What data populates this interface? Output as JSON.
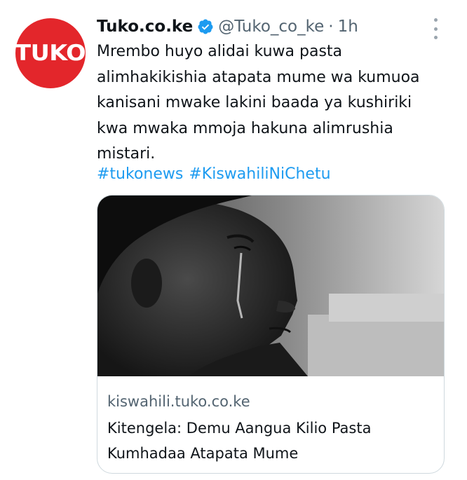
{
  "account": {
    "avatar_text": "TUKO",
    "name": "Tuko.co.ke",
    "handle": "@Tuko_co_ke",
    "separator": "·",
    "time": "1h"
  },
  "tweet": {
    "text": "Mrembo huyo alidai kuwa pasta alimhakikishia atapata mume wa kumuoa kanisani mwake lakini baada ya kushiriki kwa mwaka mmoja hakuna alimrushia mistari.",
    "hashtags": [
      "#tukonews",
      "#KiswahiliNiChetu"
    ]
  },
  "card": {
    "domain": "kiswahili.tuko.co.ke",
    "title": "Kitengela: Demu Aangua Kilio Pasta Kumhadaa Atapata Mume",
    "image": "black-and-white photo of a crying woman in profile"
  },
  "icons": {
    "verified": "verified-badge-icon",
    "more": "more-options-icon"
  },
  "colors": {
    "brand_red": "#e3262b",
    "link_blue": "#1d9bf0",
    "muted": "#536471"
  }
}
